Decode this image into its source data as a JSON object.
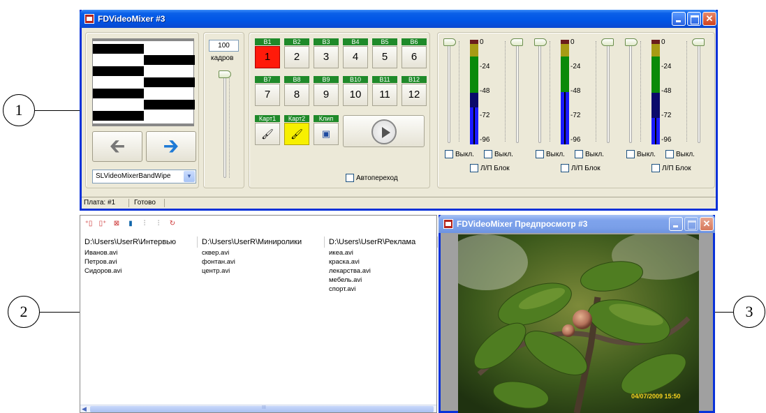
{
  "callouts": {
    "c1": "1",
    "c2": "2",
    "c3": "3"
  },
  "main_window": {
    "title": "FDVideoMixer #3",
    "frames_value": "100",
    "frames_label": "кадров",
    "transition_select": "SLVideoMixerBandWipe",
    "buses_top": [
      {
        "tag": "B1",
        "key": "1"
      },
      {
        "tag": "B2",
        "key": "2"
      },
      {
        "tag": "B3",
        "key": "3"
      },
      {
        "tag": "B4",
        "key": "4"
      },
      {
        "tag": "B5",
        "key": "5"
      },
      {
        "tag": "B6",
        "key": "6"
      }
    ],
    "buses_bottom": [
      {
        "tag": "B7",
        "key": "7"
      },
      {
        "tag": "B8",
        "key": "8"
      },
      {
        "tag": "B9",
        "key": "9"
      },
      {
        "tag": "B10",
        "key": "10"
      },
      {
        "tag": "B11",
        "key": "11"
      },
      {
        "tag": "B12",
        "key": "12"
      }
    ],
    "extra_buttons": [
      {
        "tag": "Карт1"
      },
      {
        "tag": "Карт2"
      },
      {
        "tag": "Клип"
      }
    ],
    "auto_transition": "Автопереход",
    "meter_scale": [
      "0",
      "-24",
      "-48",
      "-72",
      "-96"
    ],
    "mute_label": "Выкл.",
    "lr_lock_label": "Л/П Блок",
    "status_board": "Плата: #1",
    "status_ready": "Готово"
  },
  "file_panel": {
    "columns": [
      {
        "header": "D:\\Users\\UserR\\Интервью",
        "files": [
          "Иванов.avi",
          "Петров.avi",
          "Сидоров.avi"
        ]
      },
      {
        "header": "D:\\Users\\UserR\\Миниролики",
        "files": [
          "сквер.avi",
          "фонтан.avi",
          "центр.avi"
        ]
      },
      {
        "header": "D:\\Users\\UserR\\Реклама",
        "files": [
          "икеа.avi",
          "краска.avi",
          "лекарства.avi",
          "мебель.avi",
          "спорт.avi"
        ]
      }
    ],
    "scroll_marker": "III"
  },
  "preview_window": {
    "title": "FDVideoMixer Предпросмотр #3",
    "timestamp": "04/07/2009 15:50"
  },
  "icons": {
    "toolbar": [
      "add-folder-icon",
      "add-file-icon",
      "delete-icon",
      "color-icon",
      "split-icon",
      "merge-icon",
      "refresh-icon"
    ],
    "nav_prev": "arrow-left-icon",
    "nav_next": "arrow-right-icon",
    "play": "play-icon",
    "brush": "brush-icon",
    "film": "film-icon"
  },
  "colors": {
    "xp_blue": "#0055e5",
    "bus_tag": "#1f8a2a",
    "active_red": "#ff1a0a",
    "active_yellow": "#f7f000",
    "meter_green": "#0a8a0a",
    "meter_blue": "#1a1aff"
  }
}
